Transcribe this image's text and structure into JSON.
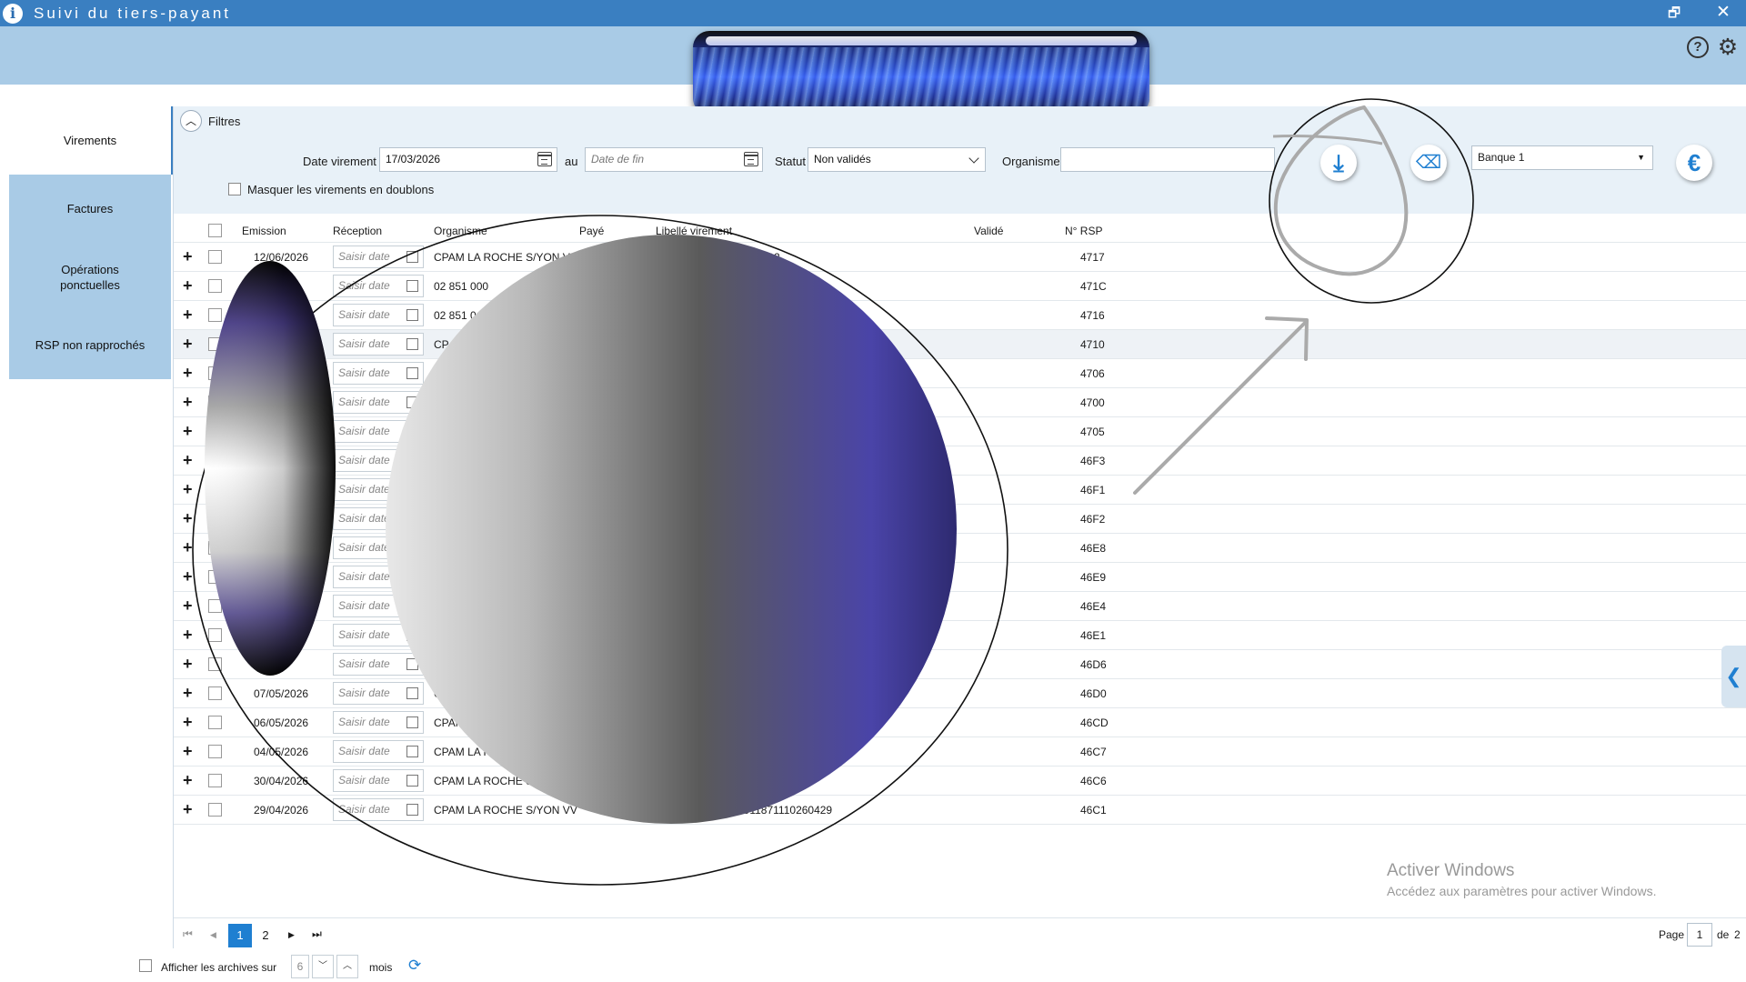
{
  "window": {
    "title": "Suivi du tiers-payant",
    "icon_letter": "i",
    "restore_glyph": "🗗",
    "close_glyph": "✕"
  },
  "header": {
    "help_glyph": "?",
    "settings_glyph": "⚙"
  },
  "nav": {
    "items": [
      {
        "label": "Virements",
        "active": true
      },
      {
        "label": "Factures",
        "active": false
      },
      {
        "label": "Opérations ponctuelles",
        "active": false
      },
      {
        "label": "RSP non rapprochés",
        "active": false
      }
    ]
  },
  "filters": {
    "title": "Filtres",
    "collapse_glyph": "︿",
    "date_label": "Date virement",
    "date_from": "17/03/2026",
    "au_label": "au",
    "date_to_placeholder": "Date de fin",
    "statut_label": "Statut",
    "statut_value": "Non validés",
    "organisme_label": "Organisme",
    "organisme_value": "",
    "bank_value": "Banque 1",
    "bank_caret": "▼",
    "masquer_label": "Masquer les virements en doublons",
    "download_glyph": "⤓",
    "eraser_glyph": "⌫",
    "euro_glyph": "€"
  },
  "grid": {
    "columns": {
      "emission": "Emission",
      "reception": "Réception",
      "organisme": "Organisme",
      "paye": "Payé",
      "libelle": "Libellé virement",
      "valide": "Validé",
      "rsp": "N° RSP"
    },
    "plus_glyph": "+",
    "reception_placeholder": "Saisir date",
    "rows": [
      {
        "emission": "12/06/2026",
        "organisme": "CPAM LA ROCHE S/YON VI",
        "libelle": "0760612",
        "rsp": "4717"
      },
      {
        "emission": "6",
        "organisme": "02 851 000",
        "libelle": "0",
        "rsp": "471C"
      },
      {
        "emission": "",
        "organisme": "02 851 0",
        "libelle": "",
        "rsp": "4716"
      },
      {
        "emission": "",
        "organisme": "CP",
        "libelle": "",
        "rsp": "4710"
      },
      {
        "emission": "",
        "organisme": "",
        "libelle": "",
        "rsp": "4706"
      },
      {
        "emission": "",
        "organisme": "",
        "libelle": "",
        "rsp": "4700"
      },
      {
        "emission": "",
        "organisme": "",
        "libelle": "",
        "rsp": "4705"
      },
      {
        "emission": "",
        "organisme": "",
        "libelle": "",
        "rsp": "46F3"
      },
      {
        "emission": "",
        "organisme": "",
        "libelle": "",
        "rsp": "46F1"
      },
      {
        "emission": "",
        "organisme": "",
        "libelle": "",
        "rsp": "46F2"
      },
      {
        "emission": "",
        "organisme": "",
        "libelle": "",
        "rsp": "46E8"
      },
      {
        "emission": "",
        "organisme": "",
        "libelle": "",
        "rsp": "46E9"
      },
      {
        "emission": "",
        "organisme": "",
        "libelle": "",
        "rsp": "46E4"
      },
      {
        "emission": "5",
        "organisme": "",
        "libelle": "",
        "rsp": "46E1"
      },
      {
        "emission": "/2026",
        "organisme": "",
        "libelle": "",
        "rsp": "46D6"
      },
      {
        "emission": "07/05/2026",
        "organisme": "C",
        "libelle": "",
        "rsp": "46D0"
      },
      {
        "emission": "06/05/2026",
        "organisme": "CPAM",
        "libelle": "",
        "rsp": "46CD"
      },
      {
        "emission": "04/05/2026",
        "organisme": "CPAM LA R",
        "libelle": "",
        "rsp": "46C7"
      },
      {
        "emission": "30/04/2026",
        "organisme": "CPAM LA ROCHE S/",
        "libelle": "0",
        "rsp": "46C6"
      },
      {
        "emission": "29/04/2026",
        "organisme": "CPAM LA ROCHE S/YON VV",
        "libelle": "0911871110260429",
        "rsp": "46C1"
      }
    ]
  },
  "watermark": {
    "line1": "Activer Windows",
    "line2": "Accédez aux paramètres pour activer Windows."
  },
  "pager": {
    "first_glyph": "⏮",
    "prev_glyph": "◀",
    "next_glyph": "▶",
    "last_glyph": "⏭",
    "pages": [
      "1",
      "2"
    ],
    "active_page": "1",
    "page_label": "Page",
    "current_page": "1",
    "of_label": "de",
    "total_pages": "2"
  },
  "archives": {
    "label": "Afficher les archives sur",
    "months_value": "6",
    "months_label": "mois",
    "down_glyph": "﹀",
    "up_glyph": "︿",
    "refresh_glyph": "⟳"
  },
  "right_tab_glyph": "❮",
  "colors": {
    "titlebar": "#3a7fc1",
    "header_band": "#a9cbe6",
    "accent": "#1f7fd1"
  }
}
